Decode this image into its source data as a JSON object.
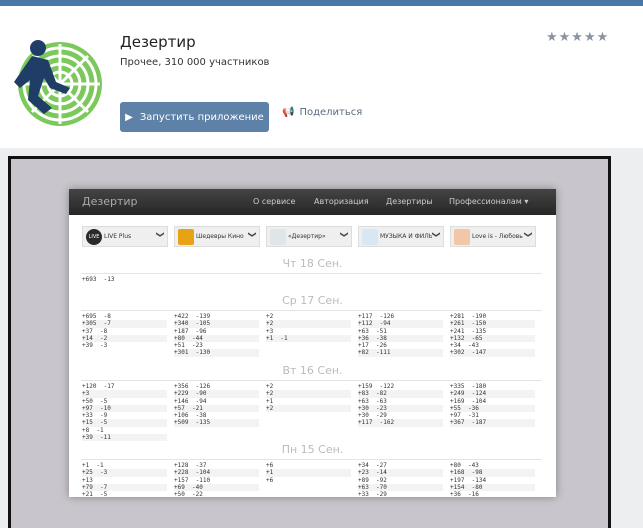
{
  "app": {
    "title": "Дезертир",
    "subtitle": "Прочее, 310 000 участников",
    "rating": "★★★★★",
    "launch_label": "Запустить приложение",
    "share_label": "Поделиться"
  },
  "inner": {
    "brand": "Дезертир",
    "nav": [
      "О сервисе",
      "Авторизация",
      "Дезертиры",
      "Профессионалам"
    ],
    "selectors": [
      {
        "label": "LIVE Plus",
        "icon_text": "LIVE",
        "icon_color": "#2a2a2a"
      },
      {
        "label": "Шедевры Кино",
        "icon_text": "",
        "icon_color": "#e8a314"
      },
      {
        "label": "«Дезертир»",
        "icon_text": "",
        "icon_color": "#dfe6ea"
      },
      {
        "label": "МУЗЫКА И ФИЛЬМЫ",
        "icon_text": "",
        "icon_color": "#d6e9f3"
      },
      {
        "label": "Love is - Любовь",
        "icon_text": "",
        "icon_color": "#f2c7a8"
      }
    ],
    "days": [
      {
        "title": "Чт 18 Сен.",
        "cells": [
          [
            "+693  -13"
          ],
          [],
          [],
          [],
          []
        ]
      },
      {
        "title": "Ср 17 Сен.",
        "cells": [
          [
            "+695  -8",
            "+305  -7",
            "+37  -8",
            "+14  -2",
            "+39  -3"
          ],
          [
            "+422  -139",
            "+340  -105",
            "+187  -96",
            "+80  -44",
            "+51  -23",
            "+301  -130"
          ],
          [
            "+2",
            "+2",
            "+3",
            "+1  -1"
          ],
          [
            "+117  -126",
            "+112  -94",
            "+63  -51",
            "+36  -38",
            "+17  -26",
            "+82  -111"
          ],
          [
            "+281  -190",
            "+261  -150",
            "+241  -135",
            "+132  -65",
            "+34  -43",
            "+302  -147"
          ]
        ]
      },
      {
        "title": "Вт 16 Сен.",
        "cells": [
          [
            "+120  -17",
            "+3",
            "+50  -5",
            "+97  -10",
            "+33  -9",
            "+15  -5",
            "+8  -1",
            "+39  -11"
          ],
          [
            "+356  -126",
            "+229  -90",
            "+146  -94",
            "+57  -21",
            "+106  -38",
            "+509  -135"
          ],
          [
            "+2",
            "+2",
            "+1",
            "+2"
          ],
          [
            "+159  -122",
            "+83  -82",
            "+63  -63",
            "+30  -23",
            "+30  -29",
            "+117  -162"
          ],
          [
            "+335  -180",
            "+249  -124",
            "+169  -104",
            "+55  -36",
            "+97  -31",
            "+367  -187"
          ]
        ]
      },
      {
        "title": "Пн 15 Сен.",
        "cells": [
          [
            "+1  -1",
            "+25  -3",
            "+13",
            "+79  -7",
            "+21  -5"
          ],
          [
            "+128  -37",
            "+228  -104",
            "+157  -110",
            "+69  -40",
            "+50  -22"
          ],
          [
            "+6",
            "+1",
            "+6"
          ],
          [
            "+34  -27",
            "+23  -14",
            "+89  -92",
            "+63  -70",
            "+33  -29"
          ],
          [
            "+80  -43",
            "+168  -98",
            "+197  -134",
            "+154  -80",
            "+36  -16"
          ]
        ]
      }
    ]
  }
}
